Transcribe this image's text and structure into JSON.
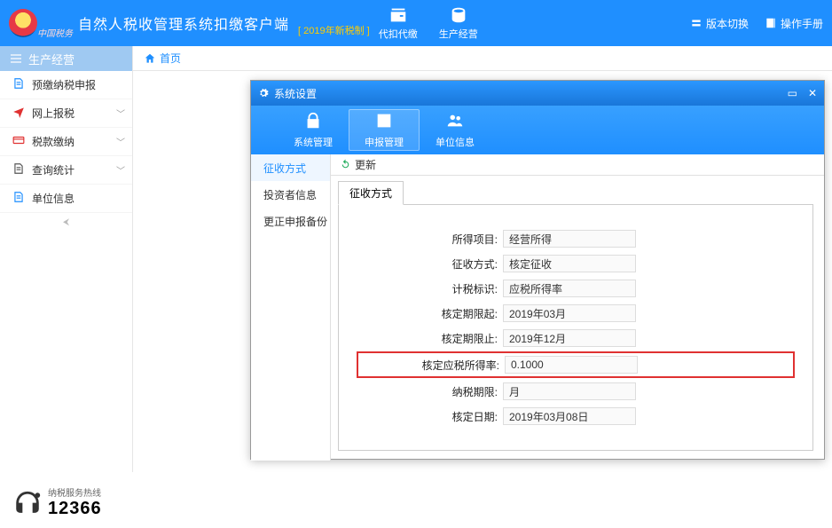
{
  "header": {
    "app_title": "自然人税收管理系统扣缴客户端",
    "new_tax": "[ 2019年新税制 ]",
    "icon1_label": "代扣代缴",
    "icon2_label": "生产经营",
    "version_switch": "版本切换",
    "manual": "操作手册"
  },
  "crumb": {
    "home": "首页"
  },
  "sidebar": {
    "title": "生产经营",
    "items": [
      {
        "label": "预缴纳税申报",
        "color": "#1f8fff",
        "icon": "doc"
      },
      {
        "label": "网上报税",
        "color": "#e03131",
        "icon": "plane",
        "chev": true
      },
      {
        "label": "税款缴纳",
        "color": "#e03131",
        "icon": "card",
        "chev": true
      },
      {
        "label": "查询统计",
        "color": "#555",
        "icon": "doc",
        "chev": true
      },
      {
        "label": "单位信息",
        "color": "#1f8fff",
        "icon": "doc"
      }
    ]
  },
  "dialog": {
    "title": "系统设置",
    "tabs": [
      {
        "label": "系统管理",
        "icon": "lock"
      },
      {
        "label": "申报管理",
        "icon": "edit",
        "active": true
      },
      {
        "label": "单位信息",
        "icon": "users"
      }
    ],
    "side": [
      {
        "label": "征收方式",
        "active": true
      },
      {
        "label": "投资者信息"
      },
      {
        "label": "更正申报备份"
      }
    ],
    "refresh": "更新",
    "inner_tab": "征收方式",
    "fields": [
      {
        "label": "所得项目:",
        "value": "经营所得"
      },
      {
        "label": "征收方式:",
        "value": "核定征收"
      },
      {
        "label": "计税标识:",
        "value": "应税所得率"
      },
      {
        "label": "核定期限起:",
        "value": "2019年03月"
      },
      {
        "label": "核定期限止:",
        "value": "2019年12月"
      },
      {
        "label": "核定应税所得率:",
        "value": "0.1000",
        "hl": true
      },
      {
        "label": "纳税期限:",
        "value": "月"
      },
      {
        "label": "核定日期:",
        "value": "2019年03月08日"
      }
    ]
  },
  "hotline": {
    "label": "纳税服务热线",
    "number": "12366"
  }
}
